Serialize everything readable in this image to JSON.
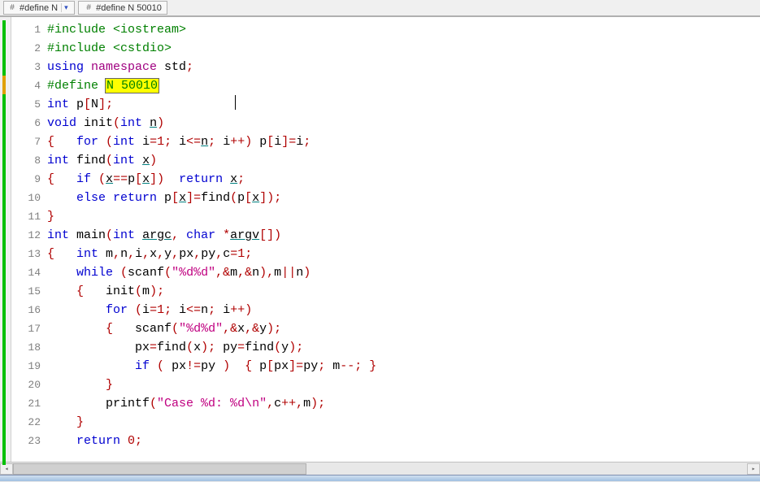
{
  "tabs": {
    "left_label": "#define N",
    "right_label": "#define N 50010"
  },
  "code_lines": [
    {
      "n": "1",
      "tokens": [
        [
          "pp",
          "#include "
        ],
        [
          "pp",
          "<iostream>"
        ]
      ]
    },
    {
      "n": "2",
      "tokens": [
        [
          "pp",
          "#include "
        ],
        [
          "pp",
          "<cstdio>"
        ]
      ]
    },
    {
      "n": "3",
      "tokens": [
        [
          "kw",
          "using "
        ],
        [
          "ty",
          "namespace "
        ],
        [
          "id",
          "std"
        ],
        [
          "op",
          ";"
        ]
      ]
    },
    {
      "n": "4",
      "tokens": [
        [
          "pp",
          "#define "
        ],
        [
          "hlbox",
          "N 50010"
        ]
      ]
    },
    {
      "n": "5",
      "tokens": [
        [
          "kw",
          "int "
        ],
        [
          "id",
          "p"
        ],
        [
          "op",
          "["
        ],
        [
          "id",
          "N"
        ],
        [
          "op",
          "];"
        ]
      ]
    },
    {
      "n": "6",
      "tokens": [
        [
          "kw",
          "void "
        ],
        [
          "id",
          "init"
        ],
        [
          "op",
          "("
        ],
        [
          "kw",
          "int "
        ],
        [
          "und",
          "n"
        ],
        [
          "op",
          ")"
        ]
      ]
    },
    {
      "n": "7",
      "tokens": [
        [
          "op",
          "{   "
        ],
        [
          "kw",
          "for "
        ],
        [
          "op",
          "("
        ],
        [
          "kw",
          "int "
        ],
        [
          "id",
          "i"
        ],
        [
          "op",
          "="
        ],
        [
          "num",
          "1"
        ],
        [
          "op",
          "; "
        ],
        [
          "id",
          "i"
        ],
        [
          "op",
          "<="
        ],
        [
          "und",
          "n"
        ],
        [
          "op",
          "; "
        ],
        [
          "id",
          "i"
        ],
        [
          "op",
          "++) "
        ],
        [
          "id",
          "p"
        ],
        [
          "op",
          "["
        ],
        [
          "id",
          "i"
        ],
        [
          "op",
          "]="
        ],
        [
          "id",
          "i"
        ],
        [
          "op",
          ";"
        ]
      ]
    },
    {
      "n": "8",
      "tokens": [
        [
          "kw",
          "int "
        ],
        [
          "id",
          "find"
        ],
        [
          "op",
          "("
        ],
        [
          "kw",
          "int "
        ],
        [
          "und",
          "x"
        ],
        [
          "op",
          ")"
        ]
      ]
    },
    {
      "n": "9",
      "tokens": [
        [
          "op",
          "{   "
        ],
        [
          "kw",
          "if "
        ],
        [
          "op",
          "("
        ],
        [
          "und",
          "x"
        ],
        [
          "op",
          "=="
        ],
        [
          "id",
          "p"
        ],
        [
          "op",
          "["
        ],
        [
          "und",
          "x"
        ],
        [
          "op",
          "])  "
        ],
        [
          "kw",
          "return "
        ],
        [
          "und",
          "x"
        ],
        [
          "op",
          ";"
        ]
      ]
    },
    {
      "n": "10",
      "tokens": [
        [
          "id",
          "    "
        ],
        [
          "kw",
          "else return "
        ],
        [
          "id",
          "p"
        ],
        [
          "op",
          "["
        ],
        [
          "und",
          "x"
        ],
        [
          "op",
          "]="
        ],
        [
          "id",
          "find"
        ],
        [
          "op",
          "("
        ],
        [
          "id",
          "p"
        ],
        [
          "op",
          "["
        ],
        [
          "und",
          "x"
        ],
        [
          "op",
          "]);"
        ]
      ]
    },
    {
      "n": "11",
      "tokens": [
        [
          "op",
          "}"
        ]
      ]
    },
    {
      "n": "12",
      "tokens": [
        [
          "kw",
          "int "
        ],
        [
          "id",
          "main"
        ],
        [
          "op",
          "("
        ],
        [
          "kw",
          "int "
        ],
        [
          "und",
          "argc"
        ],
        [
          "op",
          ", "
        ],
        [
          "kw",
          "char "
        ],
        [
          "op",
          "*"
        ],
        [
          "und",
          "argv"
        ],
        [
          "op",
          "[])"
        ]
      ]
    },
    {
      "n": "13",
      "tokens": [
        [
          "op",
          "{   "
        ],
        [
          "kw",
          "int "
        ],
        [
          "id",
          "m"
        ],
        [
          "op",
          ","
        ],
        [
          "id",
          "n"
        ],
        [
          "op",
          ","
        ],
        [
          "id",
          "i"
        ],
        [
          "op",
          ","
        ],
        [
          "id",
          "x"
        ],
        [
          "op",
          ","
        ],
        [
          "id",
          "y"
        ],
        [
          "op",
          ","
        ],
        [
          "id",
          "px"
        ],
        [
          "op",
          ","
        ],
        [
          "id",
          "py"
        ],
        [
          "op",
          ","
        ],
        [
          "id",
          "c"
        ],
        [
          "op",
          "="
        ],
        [
          "num",
          "1"
        ],
        [
          "op",
          ";"
        ]
      ]
    },
    {
      "n": "14",
      "tokens": [
        [
          "id",
          "    "
        ],
        [
          "kw",
          "while "
        ],
        [
          "op",
          "("
        ],
        [
          "id",
          "scanf"
        ],
        [
          "op",
          "("
        ],
        [
          "str",
          "\"%d%d\""
        ],
        [
          "op",
          ",&"
        ],
        [
          "id",
          "m"
        ],
        [
          "op",
          ",&"
        ],
        [
          "id",
          "n"
        ],
        [
          "op",
          "),"
        ],
        [
          "id",
          "m"
        ],
        [
          "op",
          "||"
        ],
        [
          "id",
          "n"
        ],
        [
          "op",
          ")"
        ]
      ]
    },
    {
      "n": "15",
      "tokens": [
        [
          "op",
          "    {   "
        ],
        [
          "id",
          "init"
        ],
        [
          "op",
          "("
        ],
        [
          "id",
          "m"
        ],
        [
          "op",
          ");"
        ]
      ]
    },
    {
      "n": "16",
      "tokens": [
        [
          "id",
          "        "
        ],
        [
          "kw",
          "for "
        ],
        [
          "op",
          "("
        ],
        [
          "id",
          "i"
        ],
        [
          "op",
          "="
        ],
        [
          "num",
          "1"
        ],
        [
          "op",
          "; "
        ],
        [
          "id",
          "i"
        ],
        [
          "op",
          "<="
        ],
        [
          "id",
          "n"
        ],
        [
          "op",
          "; "
        ],
        [
          "id",
          "i"
        ],
        [
          "op",
          "++)"
        ]
      ]
    },
    {
      "n": "17",
      "tokens": [
        [
          "op",
          "        {   "
        ],
        [
          "id",
          "scanf"
        ],
        [
          "op",
          "("
        ],
        [
          "str",
          "\"%d%d\""
        ],
        [
          "op",
          ",&"
        ],
        [
          "id",
          "x"
        ],
        [
          "op",
          ",&"
        ],
        [
          "id",
          "y"
        ],
        [
          "op",
          ");"
        ]
      ]
    },
    {
      "n": "18",
      "tokens": [
        [
          "id",
          "            px"
        ],
        [
          "op",
          "="
        ],
        [
          "id",
          "find"
        ],
        [
          "op",
          "("
        ],
        [
          "id",
          "x"
        ],
        [
          "op",
          "); "
        ],
        [
          "id",
          "py"
        ],
        [
          "op",
          "="
        ],
        [
          "id",
          "find"
        ],
        [
          "op",
          "("
        ],
        [
          "id",
          "y"
        ],
        [
          "op",
          ");"
        ]
      ]
    },
    {
      "n": "19",
      "tokens": [
        [
          "id",
          "            "
        ],
        [
          "kw",
          "if "
        ],
        [
          "op",
          "( "
        ],
        [
          "id",
          "px"
        ],
        [
          "op",
          "!="
        ],
        [
          "id",
          "py"
        ],
        [
          "op",
          " )  { "
        ],
        [
          "id",
          "p"
        ],
        [
          "op",
          "["
        ],
        [
          "id",
          "px"
        ],
        [
          "op",
          "]="
        ],
        [
          "id",
          "py"
        ],
        [
          "op",
          "; "
        ],
        [
          "id",
          "m"
        ],
        [
          "op",
          "--; }"
        ]
      ]
    },
    {
      "n": "20",
      "tokens": [
        [
          "op",
          "        }"
        ]
      ]
    },
    {
      "n": "21",
      "tokens": [
        [
          "id",
          "        "
        ],
        [
          "id",
          "printf"
        ],
        [
          "op",
          "("
        ],
        [
          "str",
          "\"Case %d: %d\\n\""
        ],
        [
          "op",
          ","
        ],
        [
          "id",
          "c"
        ],
        [
          "op",
          "++,"
        ],
        [
          "id",
          "m"
        ],
        [
          "op",
          ");"
        ]
      ]
    },
    {
      "n": "22",
      "tokens": [
        [
          "op",
          "    }"
        ]
      ]
    },
    {
      "n": "23",
      "tokens": [
        [
          "id",
          "    "
        ],
        [
          "kw",
          "return "
        ],
        [
          "num",
          "0"
        ],
        [
          "op",
          ";"
        ]
      ]
    }
  ]
}
